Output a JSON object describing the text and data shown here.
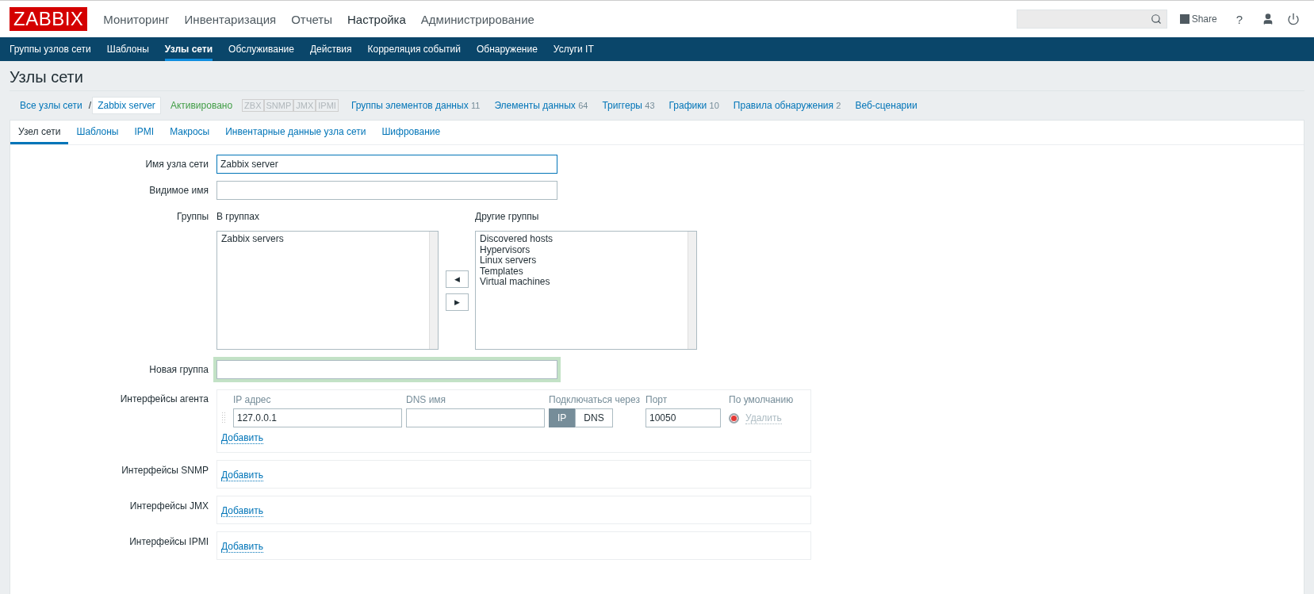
{
  "logo": "ZABBIX",
  "main_menu": [
    {
      "label": "Мониторинг",
      "selected": false
    },
    {
      "label": "Инвентаризация",
      "selected": false
    },
    {
      "label": "Отчеты",
      "selected": false
    },
    {
      "label": "Настройка",
      "selected": true
    },
    {
      "label": "Администрирование",
      "selected": false
    }
  ],
  "header_links": {
    "share": "Share",
    "help": "?"
  },
  "sub_menu": [
    {
      "label": "Группы узлов сети",
      "selected": false
    },
    {
      "label": "Шаблоны",
      "selected": false
    },
    {
      "label": "Узлы сети",
      "selected": true
    },
    {
      "label": "Обслуживание",
      "selected": false
    },
    {
      "label": "Действия",
      "selected": false
    },
    {
      "label": "Корреляция событий",
      "selected": false
    },
    {
      "label": "Обнаружение",
      "selected": false
    },
    {
      "label": "Услуги IT",
      "selected": false
    }
  ],
  "page_title": "Узлы сети",
  "breadcrumbs": [
    {
      "label": "Все узлы сети",
      "selected": false
    },
    {
      "label": "Zabbix server",
      "selected": true
    }
  ],
  "breadcrumb_separator": "/",
  "status": "Активировано",
  "availability": [
    {
      "label": "ZBX",
      "available": false
    },
    {
      "label": "SNMP",
      "available": false
    },
    {
      "label": "JMX",
      "available": false
    },
    {
      "label": "IPMI",
      "available": false
    }
  ],
  "host_links": [
    {
      "label": "Группы элементов данных",
      "count": "11"
    },
    {
      "label": "Элементы данных",
      "count": "64"
    },
    {
      "label": "Триггеры",
      "count": "43"
    },
    {
      "label": "Графики",
      "count": "10"
    },
    {
      "label": "Правила обнаружения",
      "count": "2"
    },
    {
      "label": "Веб-сценарии"
    }
  ],
  "tabs": [
    {
      "label": "Узел сети",
      "selected": true
    },
    {
      "label": "Шаблоны",
      "selected": false
    },
    {
      "label": "IPMI",
      "selected": false
    },
    {
      "label": "Макросы",
      "selected": false
    },
    {
      "label": "Инвентарные данные узла сети",
      "selected": false
    },
    {
      "label": "Шифрование",
      "selected": false
    }
  ],
  "form": {
    "host_name": {
      "label": "Имя узла сети",
      "value": "Zabbix server"
    },
    "visible_name": {
      "label": "Видимое имя"
    },
    "groups": {
      "label": "Группы",
      "in_groups": {
        "title": "В группах",
        "items": [
          "Zabbix servers"
        ]
      },
      "other_groups": {
        "title": "Другие группы",
        "items": [
          "Discovered hosts",
          "Hypervisors",
          "Linux servers",
          "Templates",
          "Virtual machines"
        ]
      },
      "move_left": "◀",
      "move_right": "▶"
    },
    "new_group": {
      "label": "Новая группа"
    },
    "agent_interfaces": {
      "label": "Интерфейсы агента",
      "columns": [
        "IP адрес",
        "DNS имя",
        "Подключаться через",
        "Порт",
        "По умолчанию"
      ],
      "rows": [
        {
          "ip": "127.0.0.1",
          "connect": [
            {
              "label": "IP",
              "selected": true
            },
            {
              "label": "DNS",
              "selected": false
            }
          ],
          "port": "10050",
          "default": true,
          "remove": {
            "label": "Удалить",
            "disabled": true
          }
        }
      ],
      "add": "Добавить"
    },
    "snmp_interfaces": {
      "label": "Интерфейсы SNMP",
      "add": "Добавить"
    },
    "jmx_interfaces": {
      "label": "Интерфейсы JMX",
      "add": "Добавить"
    },
    "ipmi_interfaces": {
      "label": "Интерфейсы IPMI",
      "add": "Добавить"
    }
  }
}
